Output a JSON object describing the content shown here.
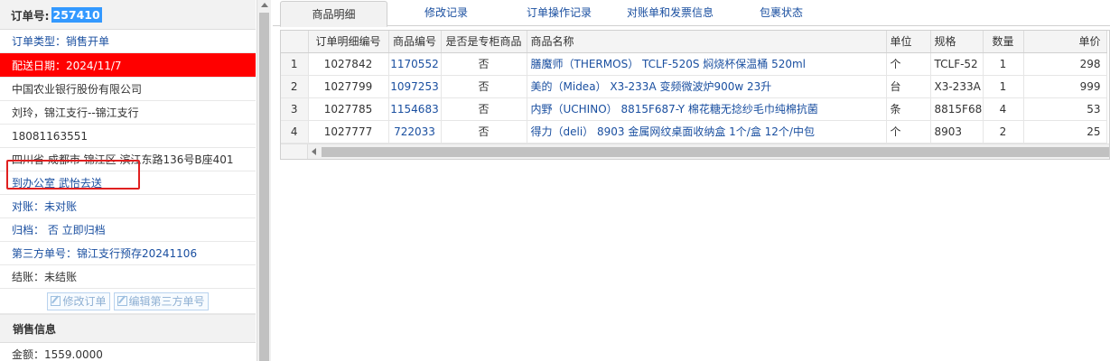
{
  "order": {
    "label": "订单号:",
    "number": "257410"
  },
  "info_rows": [
    {
      "text": "订单类型：销售开单"
    },
    {
      "text": "配送日期：2024/11/7"
    },
    {
      "text": "中国农业银行股份有限公司"
    },
    {
      "text": "刘玲，锦江支行--锦江支行"
    },
    {
      "text": "18081163551"
    },
    {
      "text": "四川省 成都市 锦江区 滨江东路136号B座401"
    },
    {
      "text": "到办公室 武怡去送"
    },
    {
      "text": "对账：未对账"
    },
    {
      "text": "归档： 否 立即归档"
    },
    {
      "text": "第三方单号：锦江支行预存20241106"
    },
    {
      "text": "结账：未结账"
    }
  ],
  "buttons": {
    "edit_order": "修改订单",
    "edit_third_party": "编辑第三方单号"
  },
  "sales_section": {
    "title": "销售信息",
    "amount": "金额：1559.0000"
  },
  "tabs": [
    {
      "label": "商品明细"
    },
    {
      "label": "修改记录"
    },
    {
      "label": "订单操作记录"
    },
    {
      "label": "对账单和发票信息"
    },
    {
      "label": "包裹状态"
    }
  ],
  "table": {
    "headers": [
      "",
      "订单明细编号",
      "商品编号",
      "是否是专柜商品",
      "商品名称",
      "单位",
      "规格",
      "数量",
      "单价"
    ],
    "rows": [
      {
        "rn": "1",
        "detail_id": "1027842",
        "product_id": "1170552",
        "counter": "否",
        "name": "膳魔师（THERMOS） TCLF-520S 焖烧杯保温桶 520ml",
        "unit": "个",
        "spec": "TCLF-52",
        "qty": "1",
        "price": "298"
      },
      {
        "rn": "2",
        "detail_id": "1027799",
        "product_id": "1097253",
        "counter": "否",
        "name": "美的（Midea） X3-233A 变频微波炉900w 23升",
        "unit": "台",
        "spec": "X3-233A",
        "qty": "1",
        "price": "999"
      },
      {
        "rn": "3",
        "detail_id": "1027785",
        "product_id": "1154683",
        "counter": "否",
        "name": "内野（UCHINO） 8815F687-Y 棉花糖无捻纱毛巾纯棉抗菌",
        "unit": "条",
        "spec": "8815F68",
        "qty": "4",
        "price": "53"
      },
      {
        "rn": "4",
        "detail_id": "1027777",
        "product_id": "722033",
        "counter": "否",
        "name": "得力（deli） 8903 金属网纹桌面收纳盒 1个/盒 12个/中包",
        "unit": "个",
        "spec": "8903",
        "qty": "2",
        "price": "25"
      }
    ]
  },
  "colors": {
    "link": "#1a4fa0",
    "highlight_red": "#ff0000",
    "selection_blue": "#3399ff"
  }
}
